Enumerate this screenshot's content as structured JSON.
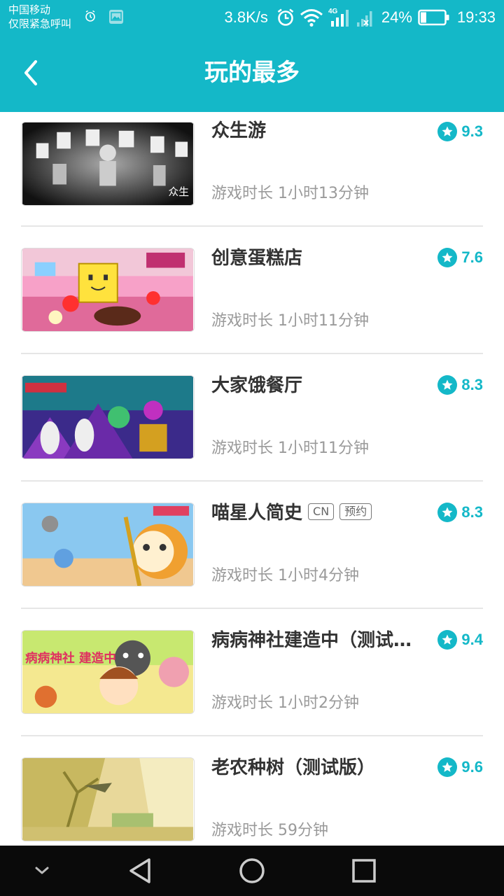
{
  "status_bar": {
    "carrier_line1": "中国移动",
    "carrier_line2": "仅限紧急呼叫",
    "net_speed": "3.8K/s",
    "network_type": "4G",
    "battery_percent": "24%",
    "battery_level": 0.24,
    "time": "19:33",
    "icons": [
      "alarm-icon",
      "image-icon",
      "alarm-clock-icon",
      "wifi-icon",
      "signal-icon",
      "signal-none-icon",
      "battery-icon"
    ]
  },
  "appbar": {
    "title": "玩的最多",
    "back_icon": "back-arrow-icon"
  },
  "colors": {
    "accent": "#14b8c8",
    "title_text": "#333333",
    "secondary_text": "#9a9a9a",
    "navbar": "#0a0a0a"
  },
  "games": [
    {
      "name": "众生游",
      "tags": [],
      "rating": "9.3",
      "playtime": "游戏时长 1小时13分钟",
      "cover_text": "众生"
    },
    {
      "name": "创意蛋糕店",
      "tags": [],
      "rating": "7.6",
      "playtime": "游戏时长 1小时11分钟",
      "cover_text": ""
    },
    {
      "name": "大家饿餐厅",
      "tags": [],
      "rating": "8.3",
      "playtime": "游戏时长 1小时11分钟",
      "cover_text": ""
    },
    {
      "name": "喵星人简史",
      "tags": [
        "CN",
        "预约"
      ],
      "rating": "8.3",
      "playtime": "游戏时长 1小时4分钟",
      "cover_text": ""
    },
    {
      "name": "病病神社建造中（测试…",
      "tags": [],
      "rating": "9.4",
      "playtime": "游戏时长 1小时2分钟",
      "cover_text": "病病神社 建造中"
    },
    {
      "name": "老农种树（测试版）",
      "tags": [],
      "rating": "9.6",
      "playtime": "游戏时长 59分钟",
      "cover_text": ""
    }
  ],
  "navbar": {
    "buttons": [
      "collapse-icon",
      "back-triangle-icon",
      "home-circle-icon",
      "recents-square-icon"
    ]
  }
}
